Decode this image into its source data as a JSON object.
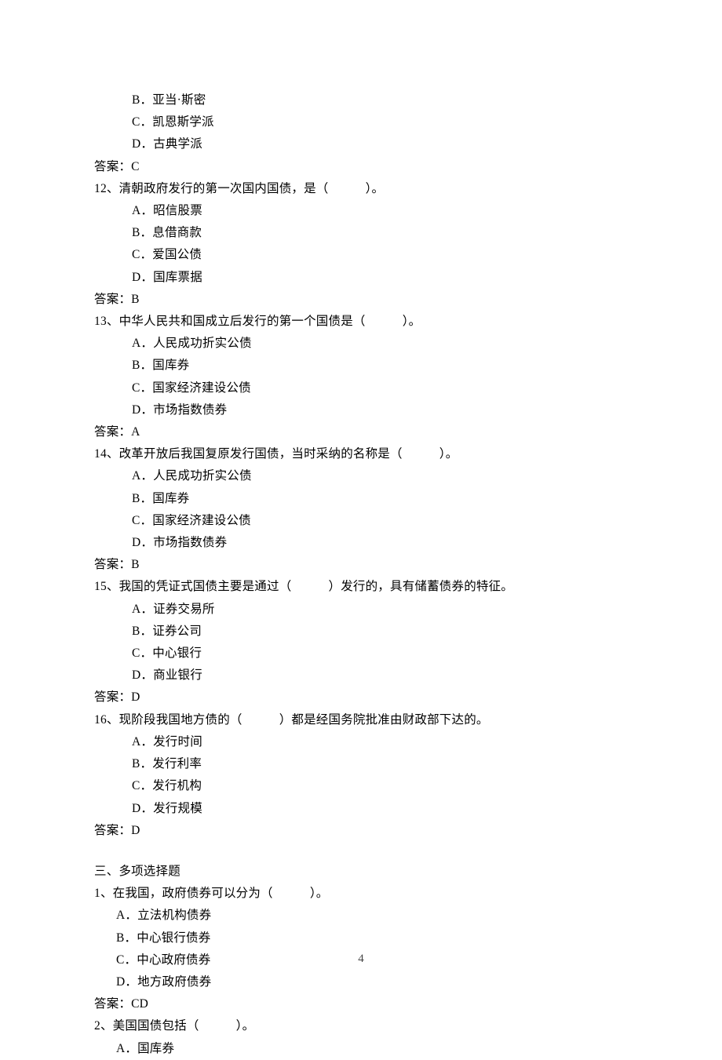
{
  "optB_11": "B．亚当·斯密",
  "optC_11": "C．凯恩斯学派",
  "optD_11": "D．古典学派",
  "ans_11": "答案：C",
  "q12": "12、清朝政府发行的第一次国内国债，是（　　　）。",
  "q12A": "A．昭信股票",
  "q12B": "B．息借商款",
  "q12C": "C．爱国公债",
  "q12D": "D．国库票据",
  "ans_12": "答案：B",
  "q13": "13、中华人民共和国成立后发行的第一个国债是（　　　）。",
  "q13A": "A．人民成功折实公债",
  "q13B": "B．国库券",
  "q13C": "C．国家经济建设公债",
  "q13D": "D．市场指数债券",
  "ans_13": "答案：A",
  "q14": "14、改革开放后我国复原发行国债，当时采纳的名称是（　　　）。",
  "q14A": "A．人民成功折实公债",
  "q14B": "B．国库券",
  "q14C": "C．国家经济建设公债",
  "q14D": "D．市场指数债券",
  "ans_14": "答案：B",
  "q15": "15、我国的凭证式国债主要是通过（　　　）发行的，具有储蓄债券的特征。",
  "q15A": "A．证券交易所",
  "q15B": "B．证券公司",
  "q15C": "C．中心银行",
  "q15D": "D．商业银行",
  "ans_15": "答案：D",
  "q16": "16、现阶段我国地方债的（　　　）都是经国务院批准由财政部下达的。",
  "q16A": "A．发行时间",
  "q16B": "B．发行利率",
  "q16C": "C．发行机构",
  "q16D": "D．发行规模",
  "ans_16": "答案：D",
  "section3": "三、多项选择题",
  "mq1": "1、在我国，政府债券可以分为（　　　）。",
  "mq1A": "A．立法机构债券",
  "mq1B": "B．中心银行债券",
  "mq1C": "C．中心政府债券",
  "mq1D": "D．地方政府债券",
  "mans1": "答案：CD",
  "mq2": "2、美国国债包括（　　　）。",
  "mq2A": "A．国库券",
  "pagenum": "4"
}
